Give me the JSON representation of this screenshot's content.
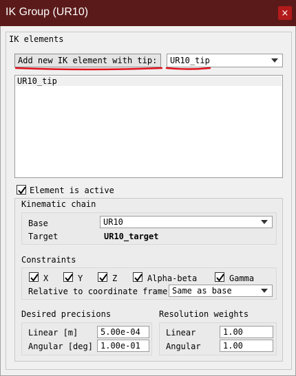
{
  "window": {
    "title": "IK Group (UR10)",
    "close_glyph": "×"
  },
  "ik_elements": {
    "section_label": "IK elements",
    "add_button_label": "Add new IK element with tip:",
    "tip_selected": "UR10_tip",
    "list": [
      "UR10_tip"
    ]
  },
  "element": {
    "active_label": "Element is active",
    "active_checked": true
  },
  "kinematic_chain": {
    "section_label": "Kinematic chain",
    "base_label": "Base",
    "base_value": "UR10",
    "target_label": "Target",
    "target_value": "UR10_target"
  },
  "constraints": {
    "section_label": "Constraints",
    "items": [
      {
        "label": "X",
        "checked": true
      },
      {
        "label": "Y",
        "checked": true
      },
      {
        "label": "Z",
        "checked": true
      },
      {
        "label": "Alpha-beta",
        "checked": true
      },
      {
        "label": "Gamma",
        "checked": true
      }
    ],
    "frame_label": "Relative to coordinate frame",
    "frame_value": "Same as base"
  },
  "precisions": {
    "section_label": "Desired precisions",
    "linear_label": "Linear [m]",
    "linear_value": "5.00e-04",
    "angular_label": "Angular [deg]",
    "angular_value": "1.00e-01"
  },
  "weights": {
    "section_label": "Resolution weights",
    "linear_label": "Linear",
    "linear_value": "1.00",
    "angular_label": "Angular",
    "angular_value": "1.00"
  },
  "colors": {
    "titlebar": "#5b1a1a",
    "close_button": "#b31b1b",
    "annotation": "#e0101a"
  }
}
